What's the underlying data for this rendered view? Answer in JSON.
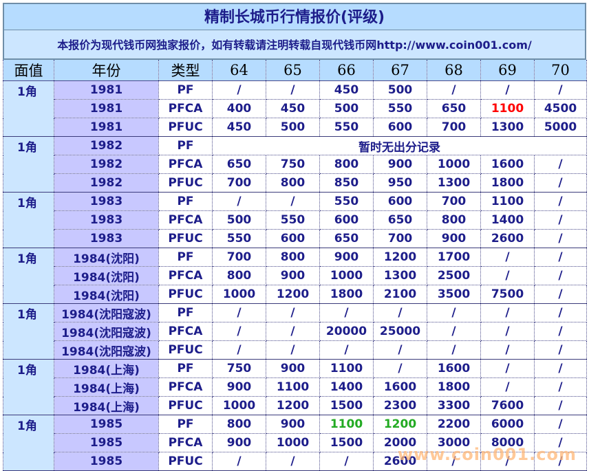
{
  "title": "精制长城币行情报价(评级)",
  "notice": "本报价为现代钱币网独家报价，如有转载请注明转载自现代钱币网http://www.coin001.com/",
  "headers": [
    "面值",
    "年份",
    "类型",
    "64",
    "65",
    "66",
    "67",
    "68",
    "69",
    "70"
  ],
  "groups": [
    {
      "face": "1角",
      "rows": [
        {
          "year": "1981",
          "type": "PF",
          "vals": [
            "/",
            "/",
            "450",
            "500",
            "/",
            "/",
            "/"
          ]
        },
        {
          "year": "1981",
          "type": "PFCA",
          "vals": [
            "400",
            "450",
            "500",
            "550",
            "650",
            "1100",
            "4500"
          ],
          "colors": {
            "5": "red"
          }
        },
        {
          "year": "1981",
          "type": "PFUC",
          "vals": [
            "450",
            "500",
            "550",
            "600",
            "700",
            "1300",
            "5000"
          ]
        }
      ]
    },
    {
      "face": "1角",
      "rows": [
        {
          "year": "1982",
          "type": "PF",
          "note": "暂时无出分记录"
        },
        {
          "year": "1982",
          "type": "PFCA",
          "vals": [
            "650",
            "750",
            "800",
            "900",
            "1000",
            "1600",
            "/"
          ]
        },
        {
          "year": "1982",
          "type": "PFUC",
          "vals": [
            "700",
            "800",
            "850",
            "950",
            "1300",
            "1800",
            "/"
          ]
        }
      ]
    },
    {
      "face": "1角",
      "rows": [
        {
          "year": "1983",
          "type": "PF",
          "vals": [
            "/",
            "/",
            "550",
            "600",
            "700",
            "1100",
            "/"
          ]
        },
        {
          "year": "1983",
          "type": "PFCA",
          "vals": [
            "500",
            "550",
            "600",
            "650",
            "800",
            "1400",
            "/"
          ]
        },
        {
          "year": "1983",
          "type": "PFUC",
          "vals": [
            "550",
            "600",
            "650",
            "700",
            "900",
            "2600",
            "/"
          ]
        }
      ]
    },
    {
      "face": "1角",
      "rows": [
        {
          "year": "1984(沈阳)",
          "type": "PF",
          "vals": [
            "700",
            "800",
            "900",
            "1200",
            "1700",
            "/",
            "/"
          ]
        },
        {
          "year": "1984(沈阳)",
          "type": "PFCA",
          "vals": [
            "800",
            "900",
            "1000",
            "1300",
            "2500",
            "/",
            "/"
          ]
        },
        {
          "year": "1984(沈阳)",
          "type": "PFUC",
          "vals": [
            "1000",
            "1200",
            "1800",
            "2100",
            "3500",
            "7500",
            "/"
          ]
        }
      ]
    },
    {
      "face": "1角",
      "rows": [
        {
          "year": "1984(沈阳寇波)",
          "type": "PF",
          "vals": [
            "/",
            "/",
            "/",
            "/",
            "/",
            "/",
            "/"
          ]
        },
        {
          "year": "1984(沈阳寇波)",
          "type": "PFCA",
          "vals": [
            "/",
            "/",
            "20000",
            "25000",
            "/",
            "/",
            "/"
          ]
        },
        {
          "year": "1984(沈阳寇波)",
          "type": "PFUC",
          "vals": [
            "/",
            "/",
            "/",
            "/",
            "/",
            "/",
            "/"
          ]
        }
      ]
    },
    {
      "face": "1角",
      "rows": [
        {
          "year": "1984(上海)",
          "type": "PF",
          "vals": [
            "750",
            "900",
            "1100",
            "/",
            "1600",
            "/",
            "/"
          ]
        },
        {
          "year": "1984(上海)",
          "type": "PFCA",
          "vals": [
            "900",
            "1100",
            "1400",
            "1600",
            "1800",
            "/",
            "/"
          ]
        },
        {
          "year": "1984(上海)",
          "type": "PFUC",
          "vals": [
            "1000",
            "1200",
            "1500",
            "2300",
            "3300",
            "7600",
            "/"
          ]
        }
      ]
    },
    {
      "face": "1角",
      "rows": [
        {
          "year": "1985",
          "type": "PF",
          "vals": [
            "800",
            "900",
            "1100",
            "1200",
            "2200",
            "6000",
            "/"
          ],
          "colors": {
            "2": "green",
            "3": "green"
          }
        },
        {
          "year": "1985",
          "type": "PFCA",
          "vals": [
            "900",
            "1000",
            "1500",
            "2000",
            "3000",
            "8000",
            "/"
          ]
        },
        {
          "year": "1985",
          "type": "PFUC",
          "vals": [
            "/",
            "/",
            "/",
            "2600",
            "/",
            "/",
            "/"
          ]
        }
      ]
    }
  ],
  "watermark": "www.coin001.com",
  "colors": {
    "red": "#ff0000",
    "green": "#22aa22",
    "text": "#1d1d8a"
  }
}
